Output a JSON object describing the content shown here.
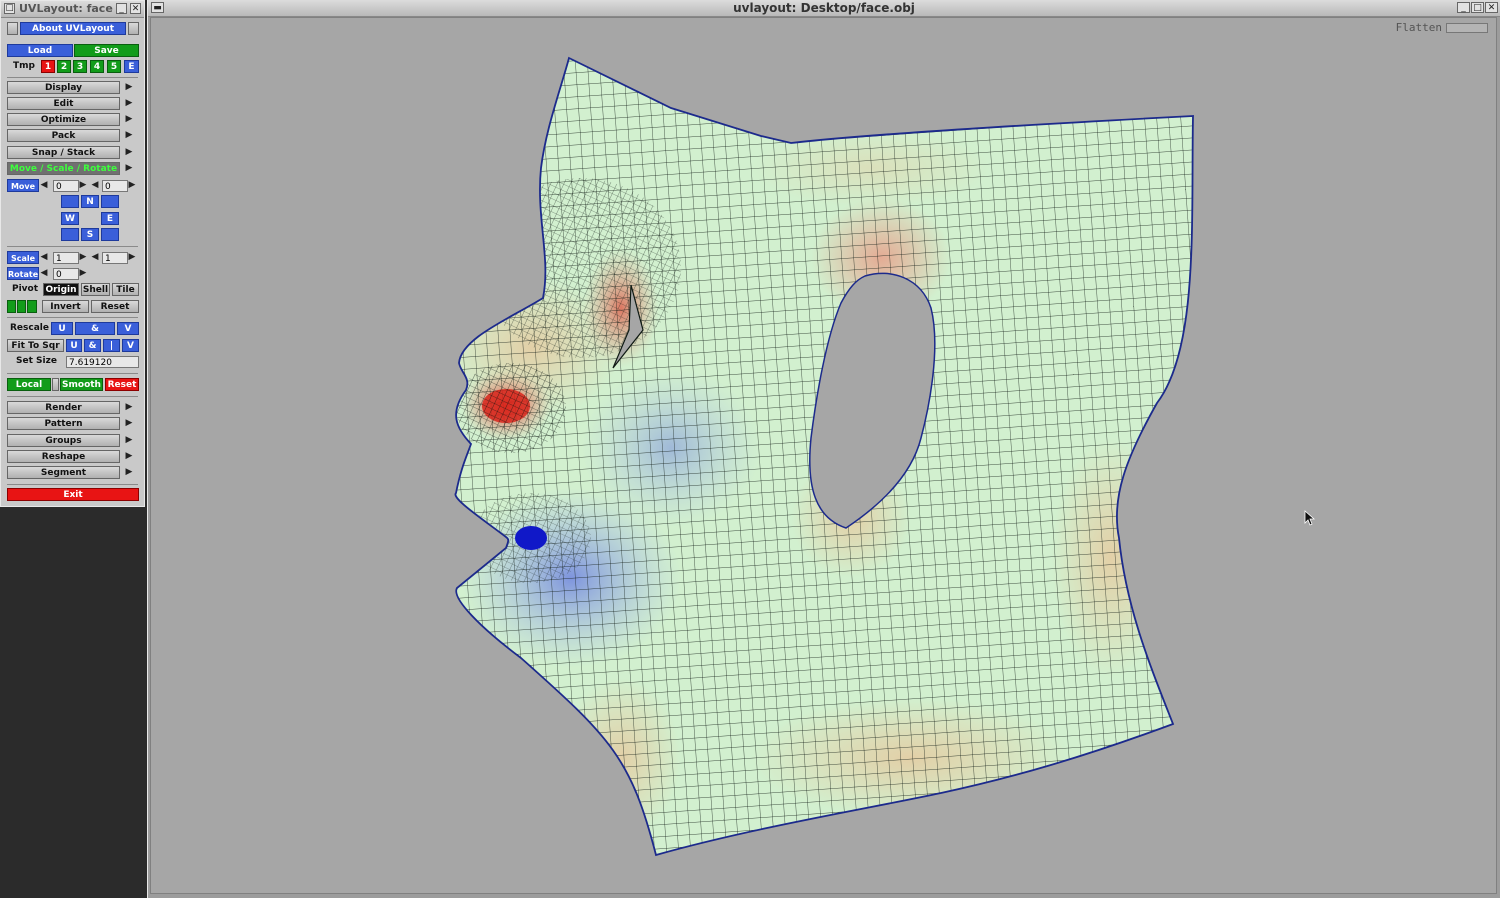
{
  "panel": {
    "title": "UVLayout: face",
    "about_label": "About UVLayout",
    "load_label": "Load",
    "save_label": "Save",
    "tmp_label": "Tmp",
    "tmp_slots": [
      "1",
      "2",
      "3",
      "4",
      "5",
      "E"
    ],
    "menus": {
      "display": "Display",
      "edit": "Edit",
      "optimize": "Optimize",
      "pack": "Pack",
      "snap": "Snap / Stack",
      "move_scale_rotate": "Move / Scale / Rotate"
    },
    "move": {
      "label": "Move",
      "value1": "0",
      "value2": "0",
      "n": "N",
      "w": "W",
      "e": "E",
      "s": "S"
    },
    "scale": {
      "label": "Scale",
      "value1": "1",
      "value2": "1"
    },
    "rotate": {
      "label": "Rotate",
      "value": "0"
    },
    "pivot": {
      "label": "Pivot",
      "origin": "Origin",
      "shell": "Shell",
      "tile": "Tile"
    },
    "invert_label": "Invert",
    "reset_label": "Reset",
    "rescale": {
      "label": "Rescale",
      "u": "U",
      "amp": "&",
      "v": "V"
    },
    "fit_to_sqr": {
      "label": "Fit To Sqr",
      "u": "U",
      "amp": "&",
      "bar": "|",
      "v": "V"
    },
    "set_size": {
      "label": "Set Size",
      "value": "7.619120"
    },
    "local_label": "Local",
    "smooth_label": "Smooth",
    "reset_red_label": "Reset",
    "menus2": {
      "render": "Render",
      "pattern": "Pattern",
      "groups": "Groups",
      "reshape": "Reshape",
      "segment": "Segment"
    },
    "exit_label": "Exit"
  },
  "main": {
    "title": "uvlayout: Desktop/face.obj",
    "flatten_label": "Flatten"
  },
  "colors": {
    "low_stretch": "#cfeecf",
    "high_stretch": "#e8b49a",
    "compression": "#1018c8",
    "outline": "#1c2a8c",
    "grid": "#0f1a14"
  }
}
